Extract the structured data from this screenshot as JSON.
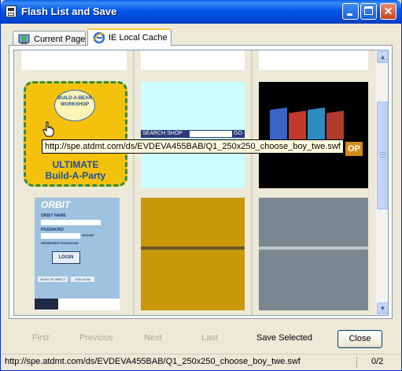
{
  "window": {
    "title": "Flash List and Save"
  },
  "tabs": [
    {
      "label": "Current Page",
      "icon": "globe-icon"
    },
    {
      "label": "IE Local Cache",
      "icon": "ie-icon"
    }
  ],
  "thumbnails": {
    "buildabear": {
      "headline": "ULTIMATE",
      "subline": "Build-A-Party",
      "badge": "BUILD-A-BEAR WORKSHOP"
    },
    "searchshop": {
      "text": "SEARCH SHOP",
      "go": "GO"
    },
    "orbit": {
      "logo": "ORBIT",
      "orbit_name_label": "ORBIT NAME",
      "password_label": "PASSWORD",
      "signup": "SIGNUP",
      "remember": "REMEMBER PASSWORD",
      "login": "LOGIN",
      "what_is": "WHAT IS ORBIT?",
      "join": "JOIN NOW"
    },
    "blocks": {
      "letters": "OP"
    }
  },
  "tooltip": "http://spe.atdmt.com/ds/EVDEVA455BAB/Q1_250x250_choose_boy_twe.swf",
  "footer": {
    "first": "First",
    "previous": "Previous",
    "next": "Next",
    "last": "Last",
    "save_selected": "Save Selected",
    "close": "Close"
  },
  "status": {
    "url": "http://spe.atdmt.com/ds/EVDEVA455BAB/Q1_250x250_choose_boy_twe.swf",
    "page": "0/2"
  }
}
